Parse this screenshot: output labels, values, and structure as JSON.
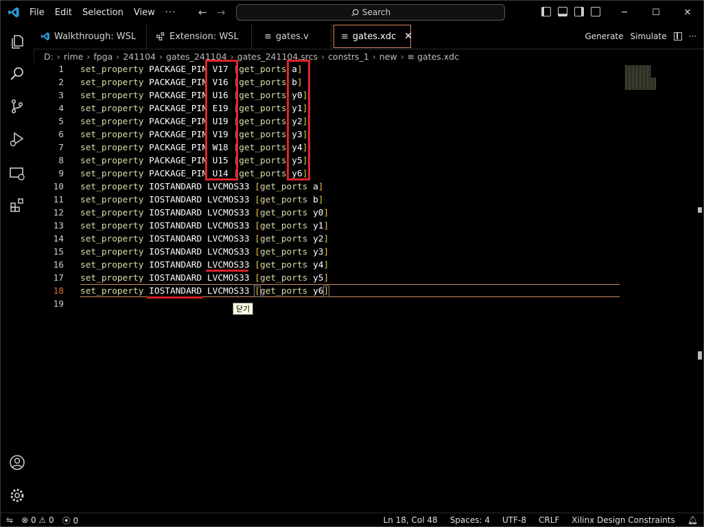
{
  "menu": [
    "File",
    "Edit",
    "Selection",
    "View",
    "···"
  ],
  "search": {
    "label": "Search"
  },
  "tabs": [
    {
      "label": "Walkthrough: WSL",
      "icon": "vscode-icon"
    },
    {
      "label": "Extension: WSL",
      "icon": "extension-icon"
    },
    {
      "label": "gates.v",
      "icon": "file-lines-icon"
    },
    {
      "label": "gates.xdc",
      "icon": "file-lines-icon",
      "active": true
    }
  ],
  "tab_actions": {
    "generate": "Generate",
    "simulate": "Simulate"
  },
  "breadcrumb": [
    "D:",
    "rime",
    "fpga",
    "241104",
    "gates_241104",
    "gates_241104.srcs",
    "constrs_1",
    "new",
    "gates.xdc"
  ],
  "line_numbers": [
    "1",
    "2",
    "3",
    "4",
    "5",
    "6",
    "7",
    "8",
    "9",
    "10",
    "11",
    "12",
    "13",
    "14",
    "15",
    "16",
    "17",
    "18",
    "19"
  ],
  "code_lines": [
    {
      "cmd": "set_property",
      "kw": "PACKAGE_PIN",
      "val": "V17",
      "gp": "get_ports",
      "port": "a"
    },
    {
      "cmd": "set_property",
      "kw": "PACKAGE_PIN",
      "val": "V16",
      "gp": "get_ports",
      "port": "b"
    },
    {
      "cmd": "set_property",
      "kw": "PACKAGE_PIN",
      "val": "U16",
      "gp": "get_ports",
      "port": "y0"
    },
    {
      "cmd": "set_property",
      "kw": "PACKAGE_PIN",
      "val": "E19",
      "gp": "get_ports",
      "port": "y1"
    },
    {
      "cmd": "set_property",
      "kw": "PACKAGE_PIN",
      "val": "U19",
      "gp": "get_ports",
      "port": "y2"
    },
    {
      "cmd": "set_property",
      "kw": "PACKAGE_PIN",
      "val": "V19",
      "gp": "get_ports",
      "port": "y3"
    },
    {
      "cmd": "set_property",
      "kw": "PACKAGE_PIN",
      "val": "W18",
      "gp": "get_ports",
      "port": "y4"
    },
    {
      "cmd": "set_property",
      "kw": "PACKAGE_PIN",
      "val": "U15",
      "gp": "get_ports",
      "port": "y5"
    },
    {
      "cmd": "set_property",
      "kw": "PACKAGE_PIN",
      "val": "U14",
      "gp": "get_ports",
      "port": "y6"
    },
    {
      "cmd": "set_property",
      "kw": "IOSTANDARD",
      "val": "LVCMOS33",
      "gp": "get_ports",
      "port": "a"
    },
    {
      "cmd": "set_property",
      "kw": "IOSTANDARD",
      "val": "LVCMOS33",
      "gp": "get_ports",
      "port": "b"
    },
    {
      "cmd": "set_property",
      "kw": "IOSTANDARD",
      "val": "LVCMOS33",
      "gp": "get_ports",
      "port": "y0"
    },
    {
      "cmd": "set_property",
      "kw": "IOSTANDARD",
      "val": "LVCMOS33",
      "gp": "get_ports",
      "port": "y1"
    },
    {
      "cmd": "set_property",
      "kw": "IOSTANDARD",
      "val": "LVCMOS33",
      "gp": "get_ports",
      "port": "y2"
    },
    {
      "cmd": "set_property",
      "kw": "IOSTANDARD",
      "val": "LVCMOS33",
      "gp": "get_ports",
      "port": "y3"
    },
    {
      "cmd": "set_property",
      "kw": "IOSTANDARD",
      "val": "LVCMOS33",
      "gp": "get_ports",
      "port": "y4"
    },
    {
      "cmd": "set_property",
      "kw": "IOSTANDARD",
      "val": "LVCMOS33",
      "gp": "get_ports",
      "port": "y5"
    },
    {
      "cmd": "set_property",
      "kw": "IOSTANDARD",
      "val": "LVCMOS33",
      "gp": "get_ports",
      "port": "y6"
    }
  ],
  "tooltip": "닫기",
  "status": {
    "errors": "0",
    "warnings": "0",
    "ports": "0",
    "position": "Ln 18, Col 48",
    "spaces": "Spaces: 4",
    "encoding": "UTF-8",
    "eol": "CRLF",
    "language": "Xilinx Design Constraints"
  },
  "colors": {
    "accent": "#d48a5f",
    "annotation_red": "#e0262c",
    "current_line_number": "#e37933",
    "bracket": "#f2c744",
    "function": "#dcdcaa"
  }
}
